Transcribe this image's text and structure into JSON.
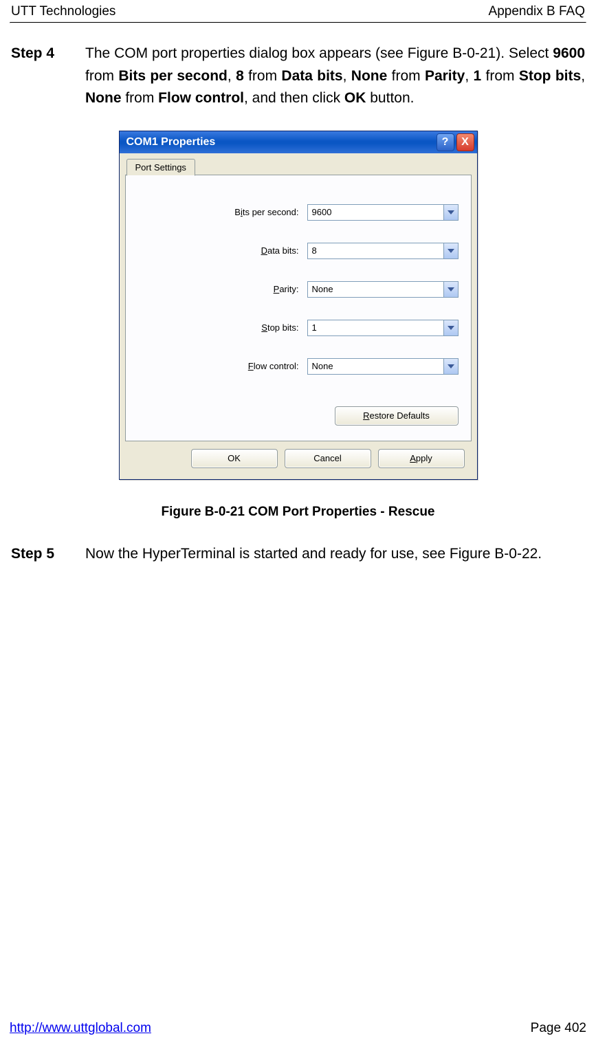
{
  "header": {
    "left": "UTT Technologies",
    "right": "Appendix B FAQ"
  },
  "footer": {
    "url": "http://www.uttglobal.com",
    "page": "Page 402"
  },
  "step4": {
    "label": "Step 4",
    "t1": "The COM port properties dialog box appears (see Figure B-0-21). Select ",
    "b1": "9600",
    "t2": " from ",
    "b2": "Bits per second",
    "t3": ", ",
    "b3": "8",
    "t4": " from ",
    "b4": "Data bits",
    "t5": ", ",
    "b5": "None",
    "t6": " from ",
    "b6": "Parity",
    "t7": ", ",
    "b7": "1",
    "t8": " from ",
    "b8": "Stop bits",
    "t9": ", ",
    "b9": "None",
    "t10": " from ",
    "b10": "Flow control",
    "t11": ", and then click ",
    "b11": "OK",
    "t12": " button."
  },
  "dialog": {
    "title": "COM1 Properties",
    "help": "?",
    "close": "X",
    "tab": "Port Settings",
    "fields": {
      "bps": {
        "pre": "B",
        "u": "i",
        "post": "ts per second:",
        "value": "9600"
      },
      "data": {
        "pre": "",
        "u": "D",
        "post": "ata bits:",
        "value": "8"
      },
      "parity": {
        "pre": "",
        "u": "P",
        "post": "arity:",
        "value": "None"
      },
      "stop": {
        "pre": "",
        "u": "S",
        "post": "top bits:",
        "value": "1"
      },
      "flow": {
        "pre": "",
        "u": "F",
        "post": "low control:",
        "value": "None"
      }
    },
    "restore": {
      "u": "R",
      "rest": "estore Defaults"
    },
    "ok": "OK",
    "cancel": "Cancel",
    "apply": {
      "u": "A",
      "rest": "pply"
    }
  },
  "figure_caption": "Figure B-0-21 COM Port Properties - Rescue",
  "step5": {
    "label": "Step 5",
    "text": "Now the HyperTerminal is started and ready for use, see Figure B-0-22."
  }
}
